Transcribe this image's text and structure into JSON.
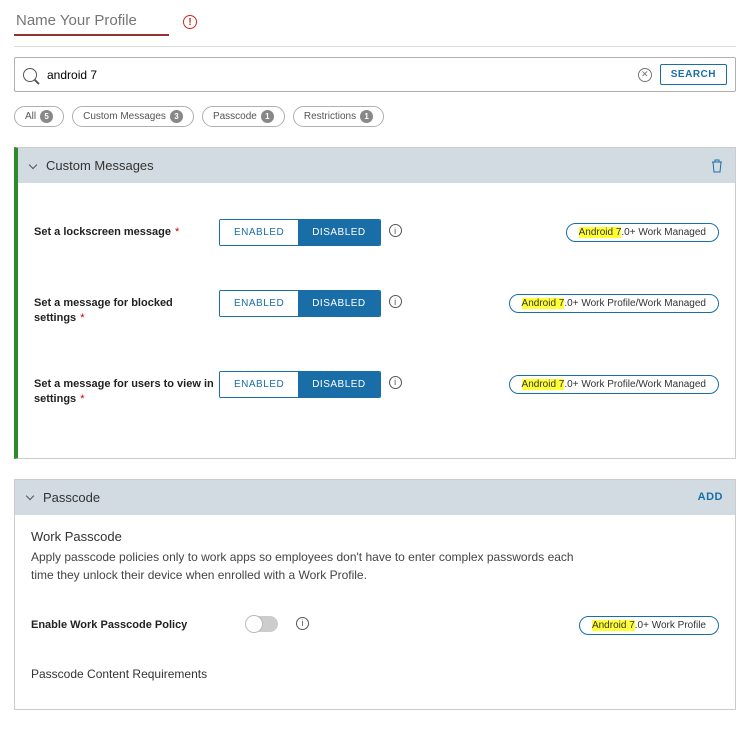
{
  "header": {
    "profile_name_placeholder": "Name Your Profile",
    "alert_glyph": "!"
  },
  "search": {
    "value": "android 7",
    "clear_glyph": "✕",
    "button_label": "SEARCH"
  },
  "chips": [
    {
      "label": "All",
      "count": "5"
    },
    {
      "label": "Custom Messages",
      "count": "3"
    },
    {
      "label": "Passcode",
      "count": "1"
    },
    {
      "label": "Restrictions",
      "count": "1"
    }
  ],
  "sections": {
    "custom_messages": {
      "title": "Custom Messages",
      "rows": [
        {
          "label": "Set a lockscreen message",
          "required": "*",
          "enabled": "ENABLED",
          "disabled": "DISABLED",
          "tag_hl": "Android 7",
          "tag_rest": ".0+ Work Managed"
        },
        {
          "label": "Set a message for blocked settings",
          "required": "*",
          "enabled": "ENABLED",
          "disabled": "DISABLED",
          "tag_hl": "Android 7",
          "tag_rest": ".0+ Work Profile/Work Managed"
        },
        {
          "label": "Set a message for users to view in settings",
          "required": "*",
          "enabled": "ENABLED",
          "disabled": "DISABLED",
          "tag_hl": "Android 7",
          "tag_rest": ".0+ Work Profile/Work Managed"
        }
      ]
    },
    "passcode": {
      "title": "Passcode",
      "add_label": "ADD",
      "sub_title": "Work Passcode",
      "description": "Apply passcode policies only to work apps so employees don't have to enter complex passwords each time they unlock their device when enrolled with a Work Profile.",
      "enable_label": "Enable Work Passcode Policy",
      "tag_hl": "Android 7",
      "tag_rest": ".0+ Work Profile",
      "content_req_heading": "Passcode Content Requirements"
    }
  },
  "info_glyph": "i"
}
